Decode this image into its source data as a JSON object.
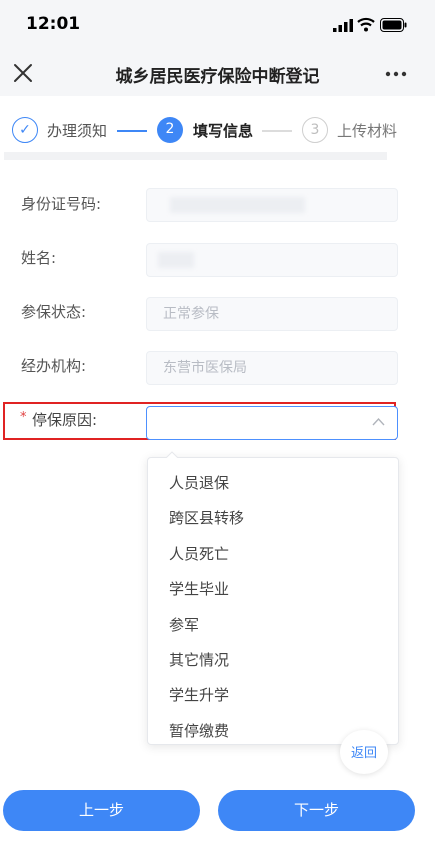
{
  "status_bar": {
    "time": "12:01"
  },
  "nav": {
    "title": "城乡居民医疗保险中断登记"
  },
  "steps": [
    {
      "number": "✓",
      "label": "办理须知"
    },
    {
      "number": "2",
      "label": "填写信息"
    },
    {
      "number": "3",
      "label": "上传材料"
    }
  ],
  "form": {
    "id_number": {
      "label": "身份证号码:",
      "value": ""
    },
    "name": {
      "label": "姓名:",
      "value": ""
    },
    "status": {
      "label": "参保状态:",
      "value": "正常参保"
    },
    "agency": {
      "label": "经办机构:",
      "value": "东营市医保局"
    },
    "reason": {
      "required_mark": "*",
      "label": "停保原因:",
      "value": ""
    }
  },
  "dropdown": {
    "options": [
      "人员退保",
      "跨区县转移",
      "人员死亡",
      "学生毕业",
      "参军",
      "其它情况",
      "学生升学",
      "暂停缴费"
    ]
  },
  "float_back": "返回",
  "buttons": {
    "prev": "上一步",
    "next": "下一步"
  },
  "colors": {
    "primary": "#3e87f6",
    "highlight": "#e02323",
    "required": "#e14040"
  }
}
